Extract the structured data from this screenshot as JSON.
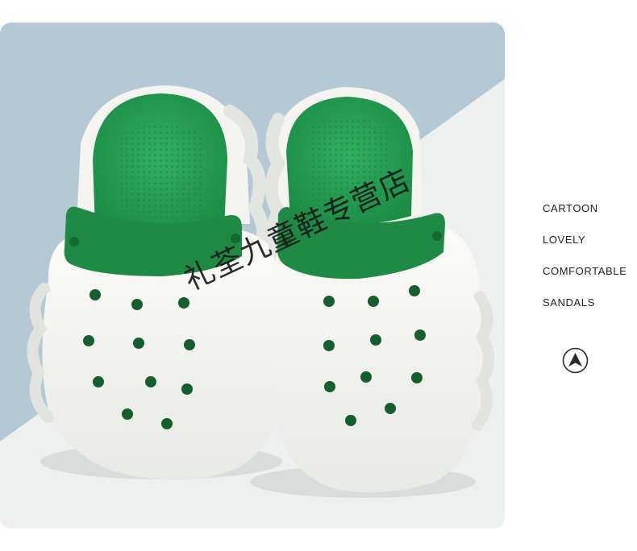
{
  "features": [
    "CARTOON",
    "LOVELY",
    "COMFORTABLE",
    "SANDALS"
  ],
  "watermark": "礼荃九童鞋专营店",
  "icons": {
    "navigation": "navigation-arrow-icon"
  },
  "colors": {
    "backdrop_blue": "#b5c8d6",
    "backdrop_white": "#eef0ef",
    "clog_white": "#f3f4f0",
    "strap_green": "#1f8a45",
    "footbed_green": "#27a356",
    "text": "#222222"
  }
}
